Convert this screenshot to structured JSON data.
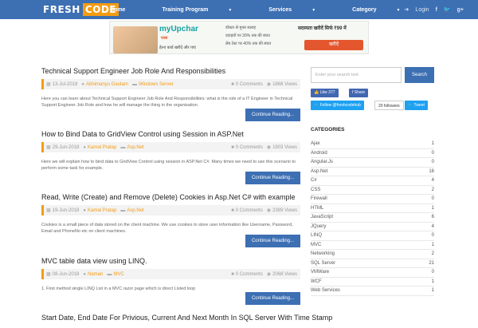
{
  "nav": {
    "logo_left": "FRESH",
    "logo_right": "CODE",
    "items": [
      {
        "label": "Home",
        "dropdown": false
      },
      {
        "label": "Training Program",
        "dropdown": true
      },
      {
        "label": "Services",
        "dropdown": true
      },
      {
        "label": "Category",
        "dropdown": true
      }
    ],
    "login": "Login"
  },
  "banner": {
    "brand": "myUpchar",
    "tagline": "प्लस",
    "subline": "हेल्थ कार्ड खरीदें और पाएं",
    "bullets": [
      "डॉक्टर से मुफ्त सलाह",
      "दवाइयों पर 30% तक की बचत",
      "लैब टेस्ट पर 40% तक की बचत"
    ],
    "headline": "सदस्यता खरीदें सिर्फ ₹99 में",
    "cta": "खरीदें"
  },
  "posts": [
    {
      "title": "Technical Support Engineer Job Role And Responsibilities",
      "date": "13-Jul-2018",
      "author": "Abhimanyu Gautam",
      "category": "Windows Server",
      "comments": "0 Comments",
      "views": "1868 Views",
      "excerpt": "Here you can learn about Technical Support Engineer Job Role And Responsibilities: what is the role of a IT Engineer in Technical Support Engineer Job Role and how he will manage the thing in the organisation.",
      "more": "Continue Reading..."
    },
    {
      "title": "How to Bind Data to GridView Control using Session in ASP.Net",
      "date": "29-Jun-2018",
      "author": "Kamal Pratap",
      "category": "Asp.Net",
      "comments": "0 Comments",
      "views": "1903 Views",
      "excerpt": "Here we will explain how to bind data to GridView Control using session in ASP.Net C#. Many times we need to use this scenario to perform some task for example.",
      "more": "Continue Reading..."
    },
    {
      "title": "Read, Write (Create) and Remove (Delete) Cookies in Asp.Net C# with example",
      "date": "19-Jun-2018",
      "author": "Kamal Pratap",
      "category": "Asp.Net",
      "comments": "0 Comments",
      "views": "2389 Views",
      "excerpt": "Cookies is a small piece of data stored on the client machine. We use cookies to store user information like Username, Password, Email and PhoneNo etc on client machines.",
      "more": "Continue Reading..."
    },
    {
      "title": "MVC table data view using LINQ.",
      "date": "08-Jun-2018",
      "author": "Naman",
      "category": "MVC",
      "comments": "0 Comments",
      "views": "2068 Views",
      "excerpt": "1. First method single LINQ List in a MVC razor page which is direct Listed loop",
      "more": "Continue Reading..."
    },
    {
      "title": "Start Date, End Date For Privious, Current And Next Month In SQL Server With Time Stamp",
      "date": "",
      "author": "",
      "category": "",
      "comments": "",
      "views": "",
      "excerpt": "",
      "more": ""
    }
  ],
  "sidebar": {
    "search_placeholder": "Enter your search text",
    "search_button": "Search",
    "fb_like": "Like 377",
    "fb_share": "Share",
    "follow": "Follow @freshcodehub",
    "followers": "20 followers",
    "tweet": "Tweet",
    "categories_title": "CATEGORIES",
    "categories": [
      {
        "name": "Ajax",
        "count": "1"
      },
      {
        "name": "Android",
        "count": "0"
      },
      {
        "name": "Angular.Js",
        "count": "0"
      },
      {
        "name": "Asp.Net",
        "count": "16"
      },
      {
        "name": "C#",
        "count": "4"
      },
      {
        "name": "CSS",
        "count": "2"
      },
      {
        "name": "Firewall",
        "count": "0"
      },
      {
        "name": "HTML",
        "count": "1"
      },
      {
        "name": "JavaScript",
        "count": "6"
      },
      {
        "name": "JQuery",
        "count": "4"
      },
      {
        "name": "LINQ",
        "count": "0"
      },
      {
        "name": "MVC",
        "count": "1"
      },
      {
        "name": "Networking",
        "count": "2"
      },
      {
        "name": "SQL Server",
        "count": "21"
      },
      {
        "name": "VMWare",
        "count": "0"
      },
      {
        "name": "WCF",
        "count": "1"
      },
      {
        "name": "Web Services",
        "count": "1"
      }
    ]
  },
  "colors": {
    "accent": "#3d6fb3",
    "orange": "#f39c12",
    "facebook": "#4267b2",
    "twitter": "#1da1f2"
  }
}
